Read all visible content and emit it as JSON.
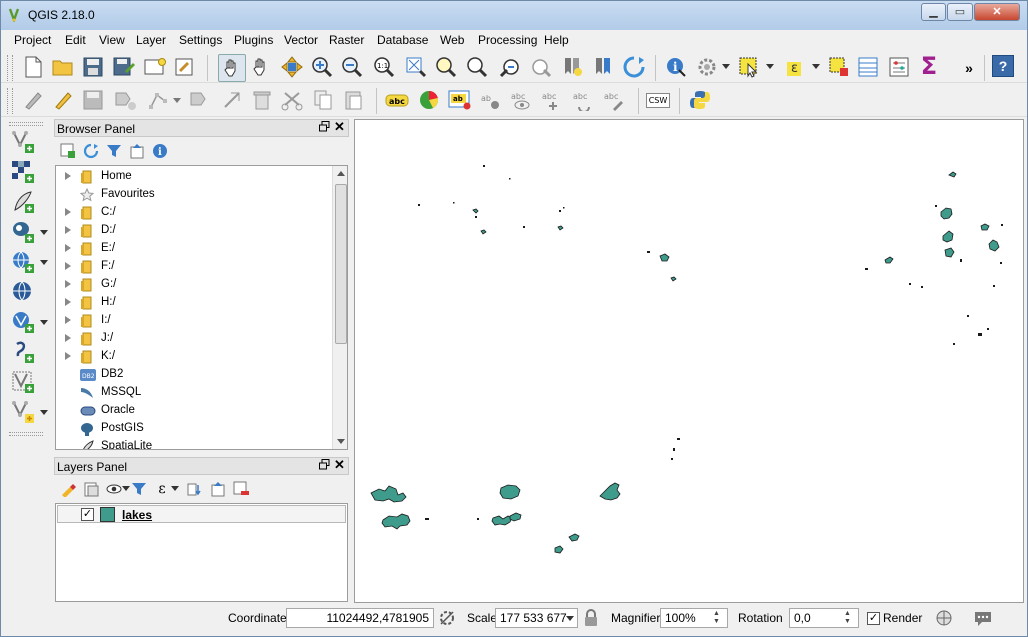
{
  "window": {
    "title": "QGIS 2.18.0",
    "minimize": "▁",
    "maximize": "▭",
    "close": "✕"
  },
  "menu": [
    "Project",
    "Edit",
    "View",
    "Layer",
    "Settings",
    "Plugins",
    "Vector",
    "Raster",
    "Database",
    "Web",
    "Processing",
    "Help"
  ],
  "toolbar": {
    "overflow": "»",
    "help": "?",
    "sigma": "Σ",
    "csw": "CSW",
    "label_abc": "abc",
    "label_ab": "ab"
  },
  "browser": {
    "title": "Browser Panel",
    "items": [
      {
        "label": "Home",
        "expandable": true,
        "icon": "folder-icon"
      },
      {
        "label": "Favourites",
        "expandable": false,
        "icon": "star-icon"
      },
      {
        "label": "C:/",
        "expandable": true,
        "icon": "folder-icon"
      },
      {
        "label": "D:/",
        "expandable": true,
        "icon": "folder-icon"
      },
      {
        "label": "E:/",
        "expandable": true,
        "icon": "folder-icon"
      },
      {
        "label": "F:/",
        "expandable": true,
        "icon": "folder-icon"
      },
      {
        "label": "G:/",
        "expandable": true,
        "icon": "folder-icon"
      },
      {
        "label": "H:/",
        "expandable": true,
        "icon": "folder-icon"
      },
      {
        "label": "I:/",
        "expandable": true,
        "icon": "folder-icon"
      },
      {
        "label": "J:/",
        "expandable": true,
        "icon": "folder-icon"
      },
      {
        "label": "K:/",
        "expandable": true,
        "icon": "folder-icon"
      },
      {
        "label": "DB2",
        "expandable": false,
        "icon": "db2-icon"
      },
      {
        "label": "MSSQL",
        "expandable": false,
        "icon": "mssql-icon"
      },
      {
        "label": "Oracle",
        "expandable": false,
        "icon": "oracle-icon"
      },
      {
        "label": "PostGIS",
        "expandable": false,
        "icon": "postgis-icon"
      },
      {
        "label": "SpatiaLite",
        "expandable": false,
        "icon": "spatialite-icon"
      }
    ],
    "db2_badge": "DB2"
  },
  "layers": {
    "title": "Layers Panel",
    "items": [
      {
        "name": "lakes",
        "checked": true,
        "color": "#3f9c8c"
      }
    ]
  },
  "colors": {
    "lake_fill": "#3f9c8c",
    "lake_stroke": "#1a1a1a"
  },
  "status": {
    "coordinate_label": "Coordinate",
    "coordinate_value": "11024492,4781905",
    "scale_label": "Scale",
    "scale_value": "177 533 677",
    "magnifier_label": "Magnifier",
    "magnifier_value": "100%",
    "rotation_label": "Rotation",
    "rotation_value": "0,0",
    "render_label": "Render",
    "render_checked": true
  }
}
